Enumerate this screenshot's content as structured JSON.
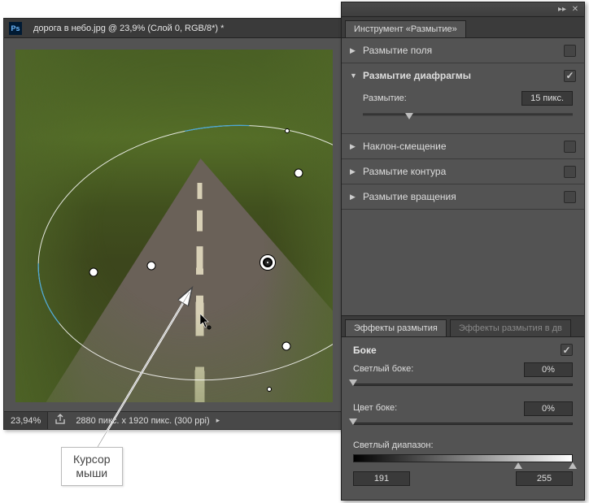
{
  "doc": {
    "title": "дорога в небо.jpg @ 23,9% (Слой 0, RGB/8*) *"
  },
  "status": {
    "zoom": "23,94%",
    "info": "2880 пикс. x 1920 пикс. (300 ppi)"
  },
  "callout": {
    "line1": "Курсор",
    "line2": "мыши"
  },
  "panel": {
    "title": "Инструмент «Размытие»",
    "sections": {
      "field": {
        "label": "Размытие поля",
        "checked": false,
        "open": false
      },
      "iris": {
        "label": "Размытие диафрагмы",
        "checked": true,
        "open": true,
        "blur_label": "Размытие:",
        "blur_value": "15 пикс."
      },
      "tilt": {
        "label": "Наклон-смещение",
        "checked": false,
        "open": false
      },
      "path": {
        "label": "Размытие контура",
        "checked": false,
        "open": false
      },
      "spin": {
        "label": "Размытие вращения",
        "checked": false,
        "open": false
      }
    },
    "effects": {
      "tab_active": "Эффекты размытия",
      "tab_inactive": "Эффекты размытия в дв",
      "bokeh": {
        "title": "Боке",
        "checked": true,
        "light_label": "Светлый боке:",
        "light_value": "0%",
        "color_label": "Цвет боке:",
        "color_value": "0%",
        "range_label": "Светлый диапазон:",
        "range_lo": "191",
        "range_hi": "255"
      }
    }
  }
}
